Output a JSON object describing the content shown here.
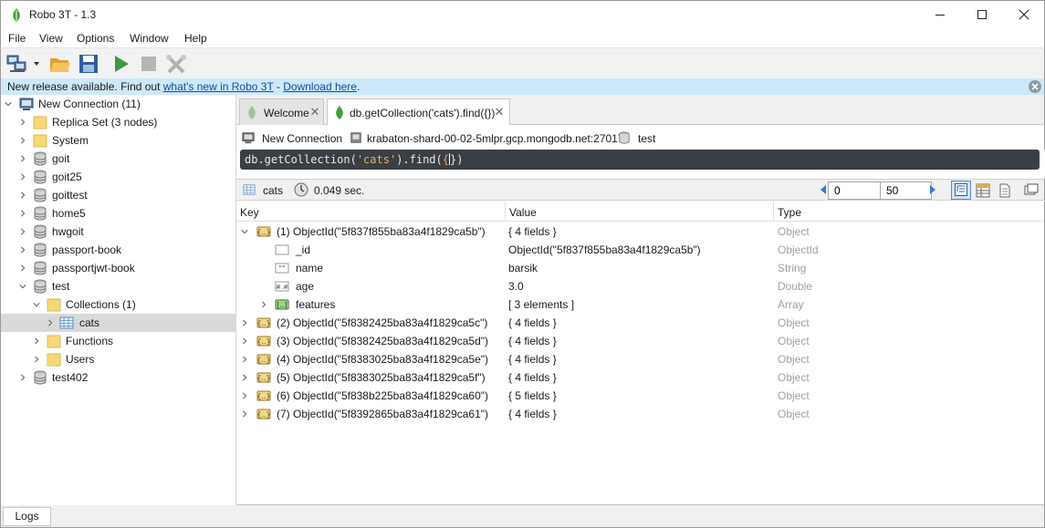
{
  "window": {
    "title": "Robo 3T - 1.3"
  },
  "menu": [
    "File",
    "View",
    "Options",
    "Window",
    "Help"
  ],
  "notification": {
    "prefix": "New release available. Find out ",
    "link1": "what's new in Robo 3T",
    "middle": " - ",
    "link2": "Download here",
    "suffix": "."
  },
  "sidebar": {
    "items": [
      {
        "label": "New Connection (11)",
        "icon": "connection-icon",
        "expanded": true
      },
      {
        "label": "Replica Set (3 nodes)",
        "icon": "folder-icon"
      },
      {
        "label": "System",
        "icon": "folder-icon"
      },
      {
        "label": "goit",
        "icon": "database-icon"
      },
      {
        "label": "goit25",
        "icon": "database-icon"
      },
      {
        "label": "goittest",
        "icon": "database-icon"
      },
      {
        "label": "home5",
        "icon": "database-icon"
      },
      {
        "label": "hwgoit",
        "icon": "database-icon"
      },
      {
        "label": "passport-book",
        "icon": "database-icon"
      },
      {
        "label": "passportjwt-book",
        "icon": "database-icon"
      },
      {
        "label": "test",
        "icon": "database-icon",
        "expanded": true
      },
      {
        "label": "Collections (1)",
        "icon": "folder-icon",
        "expanded": true
      },
      {
        "label": "cats",
        "icon": "collection-icon",
        "selected": true
      },
      {
        "label": "Functions",
        "icon": "folder-icon"
      },
      {
        "label": "Users",
        "icon": "folder-icon"
      },
      {
        "label": "test402",
        "icon": "database-icon"
      }
    ]
  },
  "tabs": [
    {
      "label": "Welcome",
      "active": false
    },
    {
      "label": "db.getCollection('cats').find({})",
      "active": true
    }
  ],
  "connection": {
    "name": "New Connection",
    "host": "krabaton-shard-00-02-5mlpr.gcp.mongodb.net:27017",
    "database": "test"
  },
  "query": {
    "part1": "db.getCollection(",
    "string": "'cats'",
    "part2": ").find(",
    "cursor": "{",
    "part3": "})"
  },
  "results": {
    "collection": "cats",
    "time": "0.049 sec.",
    "skip": "0",
    "limit": "50"
  },
  "grid": {
    "headers": {
      "key": "Key",
      "value": "Value",
      "type": "Type"
    },
    "rows": [
      {
        "key": "(1) ObjectId(\"5f837f855ba83a4f1829ca5b\")",
        "value": "{ 4 fields }",
        "type": "Object",
        "level": 0,
        "expanded": true,
        "icon": "object-icon"
      },
      {
        "key": "_id",
        "value": "ObjectId(\"5f837f855ba83a4f1829ca5b\")",
        "type": "ObjectId",
        "level": 1,
        "icon": "objectid-icon"
      },
      {
        "key": "name",
        "value": "barsik",
        "type": "String",
        "level": 1,
        "icon": "string-icon"
      },
      {
        "key": "age",
        "value": "3.0",
        "type": "Double",
        "level": 1,
        "icon": "number-icon"
      },
      {
        "key": "features",
        "value": "[ 3 elements ]",
        "type": "Array",
        "level": 1,
        "icon": "array-icon",
        "collapsed": true
      },
      {
        "key": "(2) ObjectId(\"5f8382425ba83a4f1829ca5c\")",
        "value": "{ 4 fields }",
        "type": "Object",
        "level": 0,
        "icon": "object-icon",
        "collapsed": true
      },
      {
        "key": "(3) ObjectId(\"5f8382425ba83a4f1829ca5d\")",
        "value": "{ 4 fields }",
        "type": "Object",
        "level": 0,
        "icon": "object-icon",
        "collapsed": true
      },
      {
        "key": "(4) ObjectId(\"5f8383025ba83a4f1829ca5e\")",
        "value": "{ 4 fields }",
        "type": "Object",
        "level": 0,
        "icon": "object-icon",
        "collapsed": true
      },
      {
        "key": "(5) ObjectId(\"5f8383025ba83a4f1829ca5f\")",
        "value": "{ 4 fields }",
        "type": "Object",
        "level": 0,
        "icon": "object-icon",
        "collapsed": true
      },
      {
        "key": "(6) ObjectId(\"5f838b225ba83a4f1829ca60\")",
        "value": "{ 5 fields }",
        "type": "Object",
        "level": 0,
        "icon": "object-icon",
        "collapsed": true
      },
      {
        "key": "(7) ObjectId(\"5f8392865ba83a4f1829ca61\")",
        "value": "{ 4 fields }",
        "type": "Object",
        "level": 0,
        "icon": "object-icon",
        "collapsed": true
      }
    ]
  },
  "statusbar": {
    "logs": "Logs"
  },
  "colors": {
    "notify_bg": "#cde8f8",
    "query_bg": "#3a3f44",
    "string": "#e0b070",
    "selection": "#d9d9d9",
    "type_text": "#a0a0a0"
  }
}
